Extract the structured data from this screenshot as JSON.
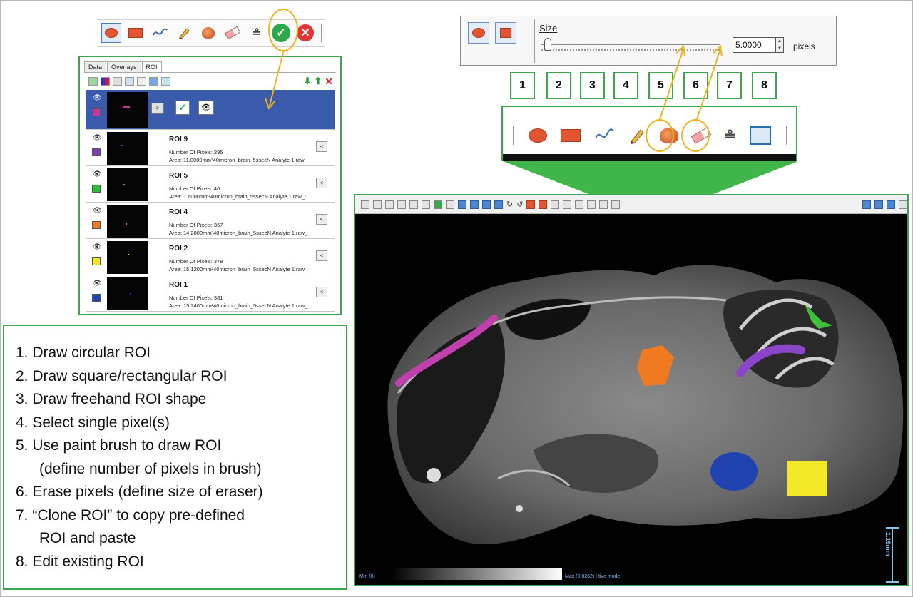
{
  "roi_panel": {
    "tabs": [
      "Data",
      "Overlays",
      "ROI"
    ],
    "rows": [
      {
        "name": "ROI 9",
        "pixels": "Number Of Pixels: 295",
        "area": "Area: 11.0000mm²40micron_brain_5ssecN Analyte 1.raw_",
        "color": "#7b3fb0"
      },
      {
        "name": "ROI 5",
        "pixels": "Number Of Pixels: 40",
        "area": "Area: 1.6000mm²40micron_brain_5ssecN Analyte 1.raw_0",
        "color": "#2ebd3a"
      },
      {
        "name": "ROI 4",
        "pixels": "Number Of Pixels: 357",
        "area": "Area: 14.2800mm²40micron_brain_5ssecN Analyte 1.raw_",
        "color": "#f07a22"
      },
      {
        "name": "ROI 2",
        "pixels": "Number Of Pixels: 378",
        "area": "Area: 15.1200mm²40micron_brain_5ssecN Analyte 1.raw_",
        "color": "#f2e826"
      },
      {
        "name": "ROI 1",
        "pixels": "Number Of Pixels: 381",
        "area": "Area: 15.2400mm²40micron_brain_5ssecN Analyte 1.raw_",
        "color": "#1f44b0"
      }
    ],
    "head_color": "#c0389b"
  },
  "legend": {
    "items": [
      "1. Draw circular ROI",
      "2. Draw square/rectangular ROI",
      "3. Draw freehand ROI shape",
      "4. Select single pixel(s)",
      "5. Use paint brush to draw ROI",
      "(define number of pixels in brush)",
      "6. Erase pixels (define size of eraser)",
      "7. “Clone ROI” to copy pre-defined",
      "ROI and paste",
      "8. Edit existing ROI"
    ]
  },
  "size_panel": {
    "label": "Size",
    "value": "5.0000",
    "unit": "pixels"
  },
  "numbers": [
    "1",
    "2",
    "3",
    "4",
    "5",
    "6",
    "7",
    "8"
  ],
  "viewer": {
    "scale_bar": "1.19mm",
    "colorbar_min": "Min (0)",
    "colorbar_max": "Max (0.0262) | tive mode"
  },
  "icons": {
    "ok": "check-icon",
    "cancel": "cancel-icon",
    "eye": "eye-icon"
  },
  "colors": {
    "highlight": "#f2b21b",
    "frame_green": "#3aa84a",
    "selected_row": "#3a5bab"
  }
}
